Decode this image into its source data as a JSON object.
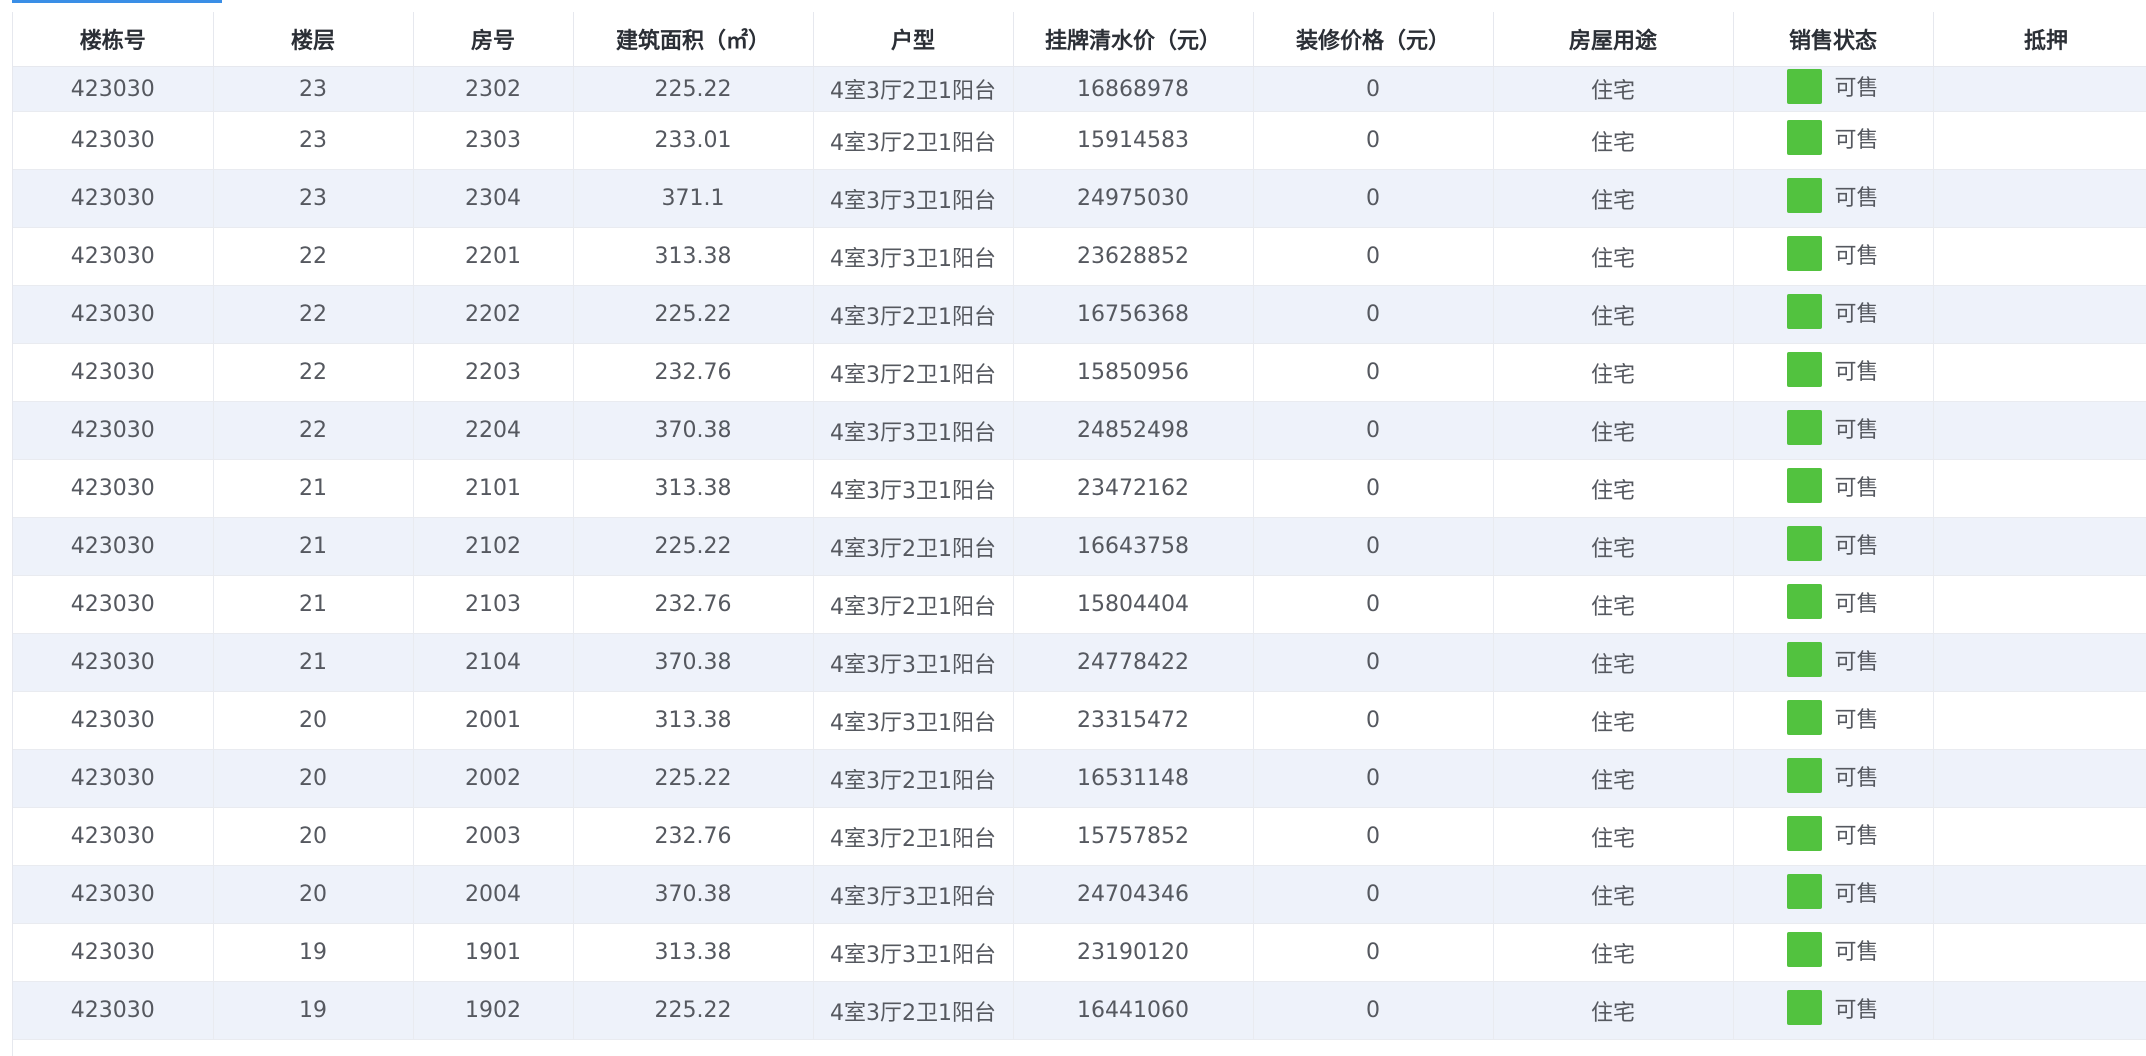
{
  "colors": {
    "available": "#52c23f",
    "accent": "#3a8ee6"
  },
  "table": {
    "headers": [
      "楼栋号",
      "楼层",
      "房号",
      "建筑面积（㎡）",
      "户型",
      "挂牌清水价（元）",
      "装修价格（元）",
      "房屋用途",
      "销售状态",
      "抵押"
    ],
    "rows": [
      [
        "423030",
        "23",
        "2302",
        "225.22",
        "4室3厅2卫1阳台",
        "16868978",
        "0",
        "住宅",
        "可售",
        ""
      ],
      [
        "423030",
        "23",
        "2303",
        "233.01",
        "4室3厅2卫1阳台",
        "15914583",
        "0",
        "住宅",
        "可售",
        ""
      ],
      [
        "423030",
        "23",
        "2304",
        "371.1",
        "4室3厅3卫1阳台",
        "24975030",
        "0",
        "住宅",
        "可售",
        ""
      ],
      [
        "423030",
        "22",
        "2201",
        "313.38",
        "4室3厅3卫1阳台",
        "23628852",
        "0",
        "住宅",
        "可售",
        ""
      ],
      [
        "423030",
        "22",
        "2202",
        "225.22",
        "4室3厅2卫1阳台",
        "16756368",
        "0",
        "住宅",
        "可售",
        ""
      ],
      [
        "423030",
        "22",
        "2203",
        "232.76",
        "4室3厅2卫1阳台",
        "15850956",
        "0",
        "住宅",
        "可售",
        ""
      ],
      [
        "423030",
        "22",
        "2204",
        "370.38",
        "4室3厅3卫1阳台",
        "24852498",
        "0",
        "住宅",
        "可售",
        ""
      ],
      [
        "423030",
        "21",
        "2101",
        "313.38",
        "4室3厅3卫1阳台",
        "23472162",
        "0",
        "住宅",
        "可售",
        ""
      ],
      [
        "423030",
        "21",
        "2102",
        "225.22",
        "4室3厅2卫1阳台",
        "16643758",
        "0",
        "住宅",
        "可售",
        ""
      ],
      [
        "423030",
        "21",
        "2103",
        "232.76",
        "4室3厅2卫1阳台",
        "15804404",
        "0",
        "住宅",
        "可售",
        ""
      ],
      [
        "423030",
        "21",
        "2104",
        "370.38",
        "4室3厅3卫1阳台",
        "24778422",
        "0",
        "住宅",
        "可售",
        ""
      ],
      [
        "423030",
        "20",
        "2001",
        "313.38",
        "4室3厅3卫1阳台",
        "23315472",
        "0",
        "住宅",
        "可售",
        ""
      ],
      [
        "423030",
        "20",
        "2002",
        "225.22",
        "4室3厅2卫1阳台",
        "16531148",
        "0",
        "住宅",
        "可售",
        ""
      ],
      [
        "423030",
        "20",
        "2003",
        "232.76",
        "4室3厅2卫1阳台",
        "15757852",
        "0",
        "住宅",
        "可售",
        ""
      ],
      [
        "423030",
        "20",
        "2004",
        "370.38",
        "4室3厅3卫1阳台",
        "24704346",
        "0",
        "住宅",
        "可售",
        ""
      ],
      [
        "423030",
        "19",
        "1901",
        "313.38",
        "4室3厅3卫1阳台",
        "23190120",
        "0",
        "住宅",
        "可售",
        ""
      ],
      [
        "423030",
        "19",
        "1902",
        "225.22",
        "4室3厅2卫1阳台",
        "16441060",
        "0",
        "住宅",
        "可售",
        ""
      ]
    ]
  }
}
